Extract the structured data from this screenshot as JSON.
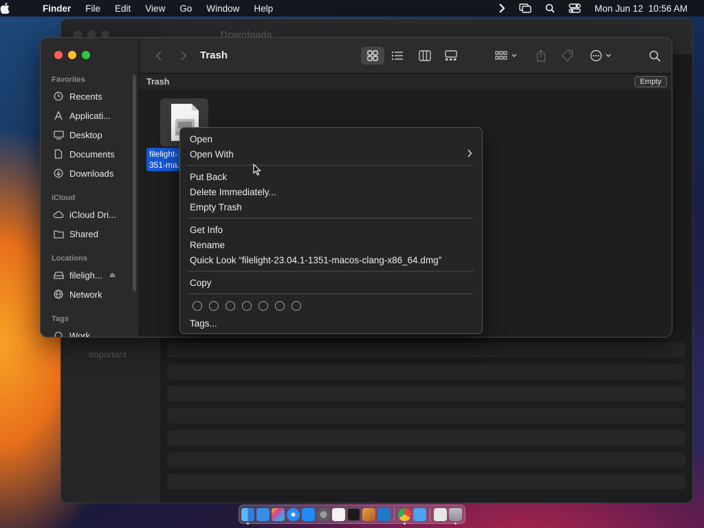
{
  "menubar": {
    "app_name": "Finder",
    "items": [
      "File",
      "Edit",
      "View",
      "Go",
      "Window",
      "Help"
    ],
    "datetime": "Mon Jun 12  10:56 AM"
  },
  "background_window": {
    "title": "Downloads",
    "sidebar_tag": "Important"
  },
  "window": {
    "title": "Trash",
    "path_title": "Trash",
    "empty_button": "Empty",
    "sidebar": {
      "favorites_header": "Favorites",
      "favorites": [
        "Recents",
        "Applicati...",
        "Desktop",
        "Documents",
        "Downloads"
      ],
      "icloud_header": "iCloud",
      "icloud": [
        "iCloud Dri...",
        "Shared"
      ],
      "locations_header": "Locations",
      "locations": [
        "fileligh...",
        "Network"
      ],
      "tags_header": "Tags",
      "tags": [
        "Work"
      ]
    },
    "file": {
      "label_line1": "filelight-",
      "label_line2": "351-ma..."
    }
  },
  "context_menu": {
    "open": "Open",
    "open_with": "Open With",
    "put_back": "Put Back",
    "delete_immediately": "Delete Immediately...",
    "empty_trash": "Empty Trash",
    "get_info": "Get Info",
    "rename": "Rename",
    "quick_look": "Quick Look “filelight-23.04.1-1351-macos-clang-x86_64.dmg”",
    "copy": "Copy",
    "tags": "Tags..."
  },
  "colors": {
    "selection_blue": "#1558d6",
    "traffic_red": "#fe5f57",
    "traffic_yellow": "#febc2e",
    "traffic_green": "#28c840"
  }
}
